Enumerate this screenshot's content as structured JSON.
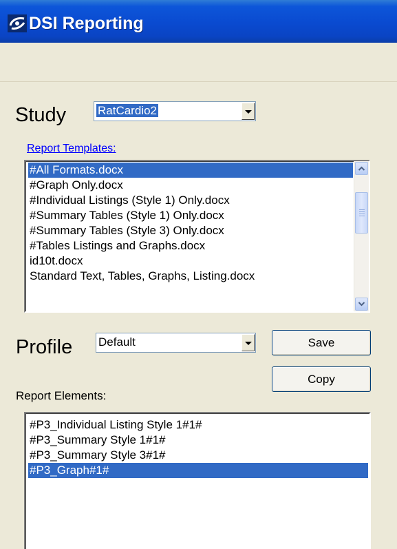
{
  "window": {
    "title": "DSI Reporting"
  },
  "study": {
    "label": "Study",
    "value": "RatCardio2"
  },
  "report_templates": {
    "link_label": "Report Templates:",
    "items": [
      "#All Formats.docx",
      "#Graph Only.docx",
      "#Individual Listings (Style 1) Only.docx",
      "#Summary Tables (Style 1) Only.docx",
      "#Summary Tables (Style 3) Only.docx",
      "#Tables Listings and Graphs.docx",
      "id10t.docx",
      "Standard Text, Tables, Graphs, Listing.docx"
    ],
    "selected_index": 0
  },
  "profile": {
    "label": "Profile",
    "value": "Default",
    "save_label": "Save",
    "copy_label": "Copy"
  },
  "report_elements": {
    "label": "Report Elements:",
    "items": [
      "#P3_Individual Listing Style 1#1#",
      "#P3_Summary Style 1#1#",
      "#P3_Summary Style 3#1#",
      "#P3_Graph#1#"
    ],
    "selected_index": 3
  },
  "colors": {
    "title_bar": "#0a4ad0",
    "selection": "#316ac5",
    "background": "#ece9d8",
    "link": "#0000ff"
  },
  "icons": {
    "app": "dsi-logo-icon",
    "combo_arrow": "chevron-down-icon",
    "scroll_up": "scroll-up-arrow-icon",
    "scroll_down": "scroll-down-arrow-icon"
  }
}
